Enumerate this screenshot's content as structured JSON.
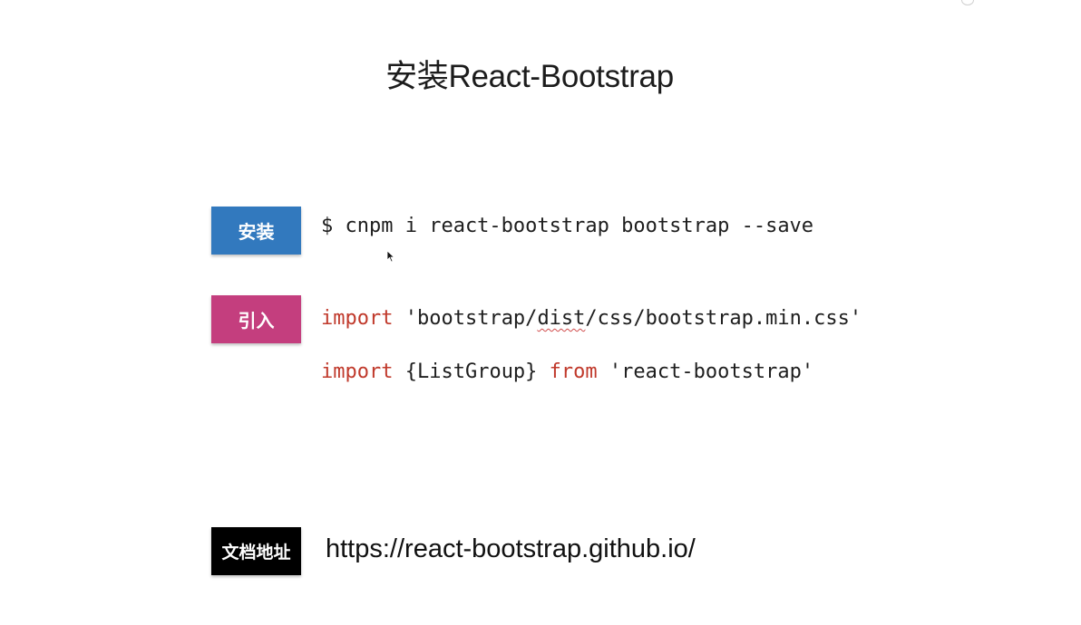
{
  "slide": {
    "title": "安装React-Bootstrap"
  },
  "install": {
    "tag_label": "安装",
    "command": "$ cnpm i react-bootstrap bootstrap --save",
    "tag_color": "#3279be"
  },
  "import": {
    "tag_label": "引入",
    "tag_color": "#c43e7e",
    "line1": {
      "keyword": "import",
      "path_pre": " 'bootstrap/",
      "path_squiggle": "dist",
      "path_post": "/css/bootstrap.min.css'"
    },
    "line2": {
      "keyword": "import",
      "middle": " {ListGroup} ",
      "keyword2": "from",
      "module": " 'react-bootstrap'"
    },
    "keyword_color": "#c0392b"
  },
  "docs": {
    "tag_label": "文档地址",
    "url": "https://react-bootstrap.github.io/",
    "tag_color": "#000000"
  }
}
